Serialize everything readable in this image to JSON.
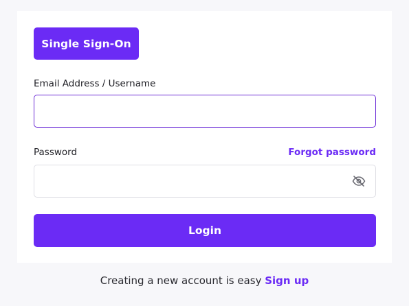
{
  "sso": {
    "label": "Single Sign-On"
  },
  "email": {
    "label": "Email Address / Username",
    "value": "",
    "placeholder": ""
  },
  "password": {
    "label": "Password",
    "value": "",
    "placeholder": "",
    "forgot_label": "Forgot password",
    "toggle_icon": "eye-off-icon"
  },
  "login": {
    "label": "Login"
  },
  "footer": {
    "prompt": "Creating a new account is easy",
    "signup_label": "Sign up"
  },
  "colors": {
    "accent": "#6b2bf5",
    "page_background": "#f7f7fa",
    "card_background": "#ffffff",
    "input_border": "#dedee4",
    "text": "#1e1e24"
  }
}
